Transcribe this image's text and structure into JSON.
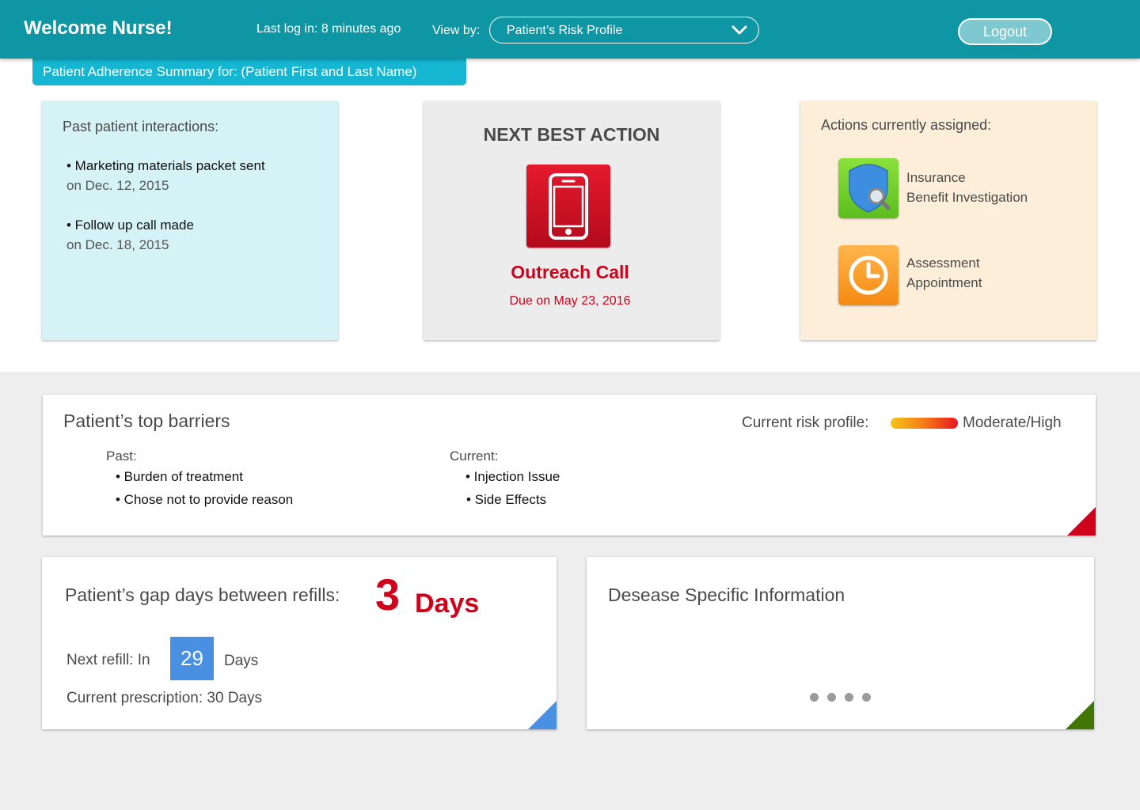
{
  "header": {
    "welcome": "Welcome Nurse!",
    "last_login": "Last log in: 8 minutes ago",
    "view_by_label": "View by:",
    "view_by_value": "Patient’s Risk Profile",
    "logout_label": "Logout"
  },
  "summary_tab": "Patient Adherence Summary for: (Patient First and Last Name)",
  "past_interactions": {
    "title": "Past patient interactions:",
    "items": [
      {
        "text": "• Marketing materials packet sent",
        "date": "on Dec. 12, 2015"
      },
      {
        "text": "• Follow up call made",
        "date": "on Dec. 18, 2015"
      }
    ]
  },
  "next_best_action": {
    "title": "NEXT BEST ACTION",
    "icon": "smartphone-icon",
    "action": "Outreach Call",
    "due": "Due on May 23, 2016"
  },
  "actions_assigned": {
    "title": "Actions currently assigned:",
    "items": [
      {
        "icon": "shield-search-icon",
        "line1": "Insurance",
        "line2": "Benefit Investigation"
      },
      {
        "icon": "clock-icon",
        "line1": "Assessment",
        "line2": "Appointment"
      }
    ]
  },
  "barriers": {
    "title": "Patient’s top barriers",
    "risk_label": "Current risk profile:",
    "risk_value": "Moderate/High",
    "past_title": "Past:",
    "past_items": [
      "• Burden of treatment",
      "• Chose not to provide reason"
    ],
    "current_title": "Current:",
    "current_items": [
      "• Injection Issue",
      "• Side Effects"
    ]
  },
  "gap": {
    "title": "Patient’s gap days between refills:",
    "value": "3",
    "unit": "Days",
    "next_refill_label": "Next refill: In",
    "next_refill_value": "29",
    "next_refill_unit": "Days",
    "prescription": "Current prescription: 30 Days"
  },
  "disease": {
    "title": "Desease Specific Information"
  },
  "colors": {
    "header": "#0e96a5",
    "accent_red": "#d0021b",
    "accent_blue": "#4a90e2",
    "accent_green": "#417505"
  }
}
